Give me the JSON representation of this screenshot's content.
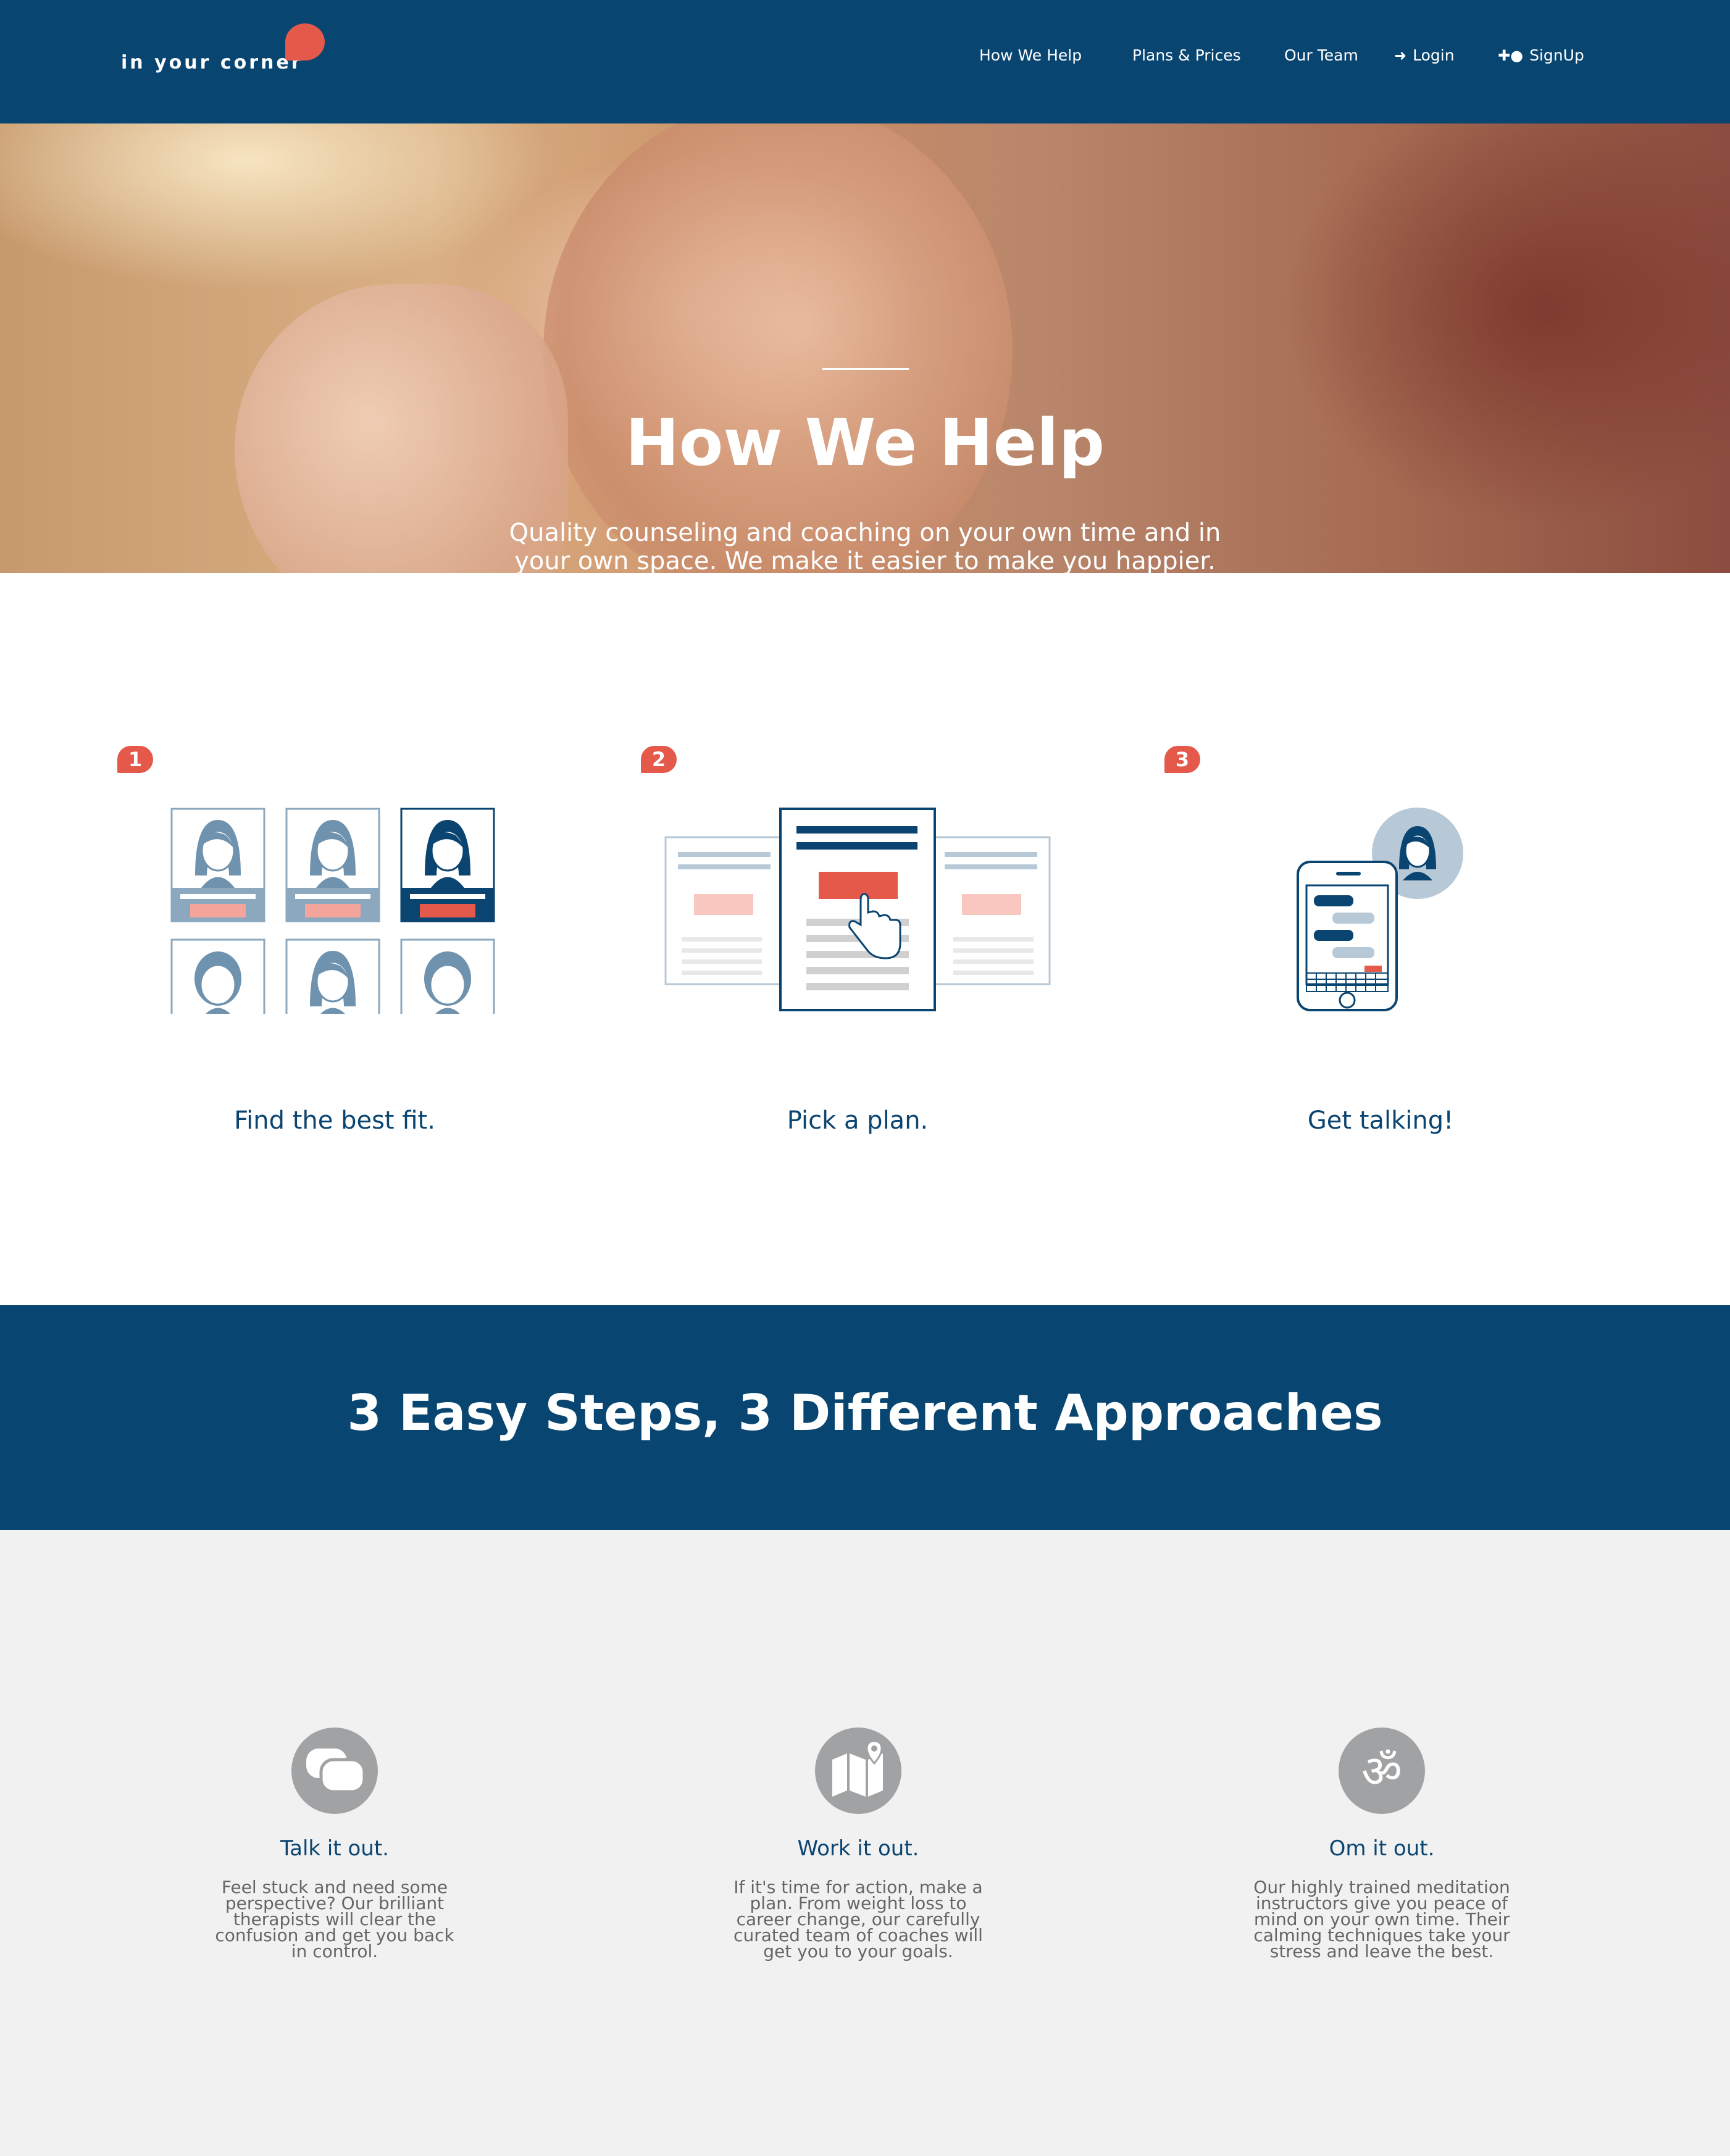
{
  "nav": {
    "logo": "in your corner",
    "links": [
      {
        "label": "How We Help",
        "icon": ""
      },
      {
        "label": "Plans & Prices",
        "icon": ""
      },
      {
        "label": "Our Team",
        "icon": ""
      },
      {
        "label": "Login",
        "icon": "login-icon"
      },
      {
        "label": "SignUp",
        "icon": "add-user-icon"
      }
    ]
  },
  "hero": {
    "title": "How We Help",
    "subtitle": "Quality counseling and coaching on your own time and in your own space. We make it easier to make you happier."
  },
  "steps": [
    {
      "number": "1",
      "caption": "Find the best fit."
    },
    {
      "number": "2",
      "caption": "Pick a plan."
    },
    {
      "number": "3",
      "caption": "Get talking!"
    }
  ],
  "band": {
    "title": "3 Easy Steps, 3 Different Approaches"
  },
  "approaches": [
    {
      "icon": "chat-bubbles-icon",
      "title": "Talk it out.",
      "text": "Feel stuck and need some perspective? Our brilliant therapists will clear the confusion and get you back in control."
    },
    {
      "icon": "map-pin-icon",
      "title": "Work it out.",
      "text": "If it's time for action, make a plan. From weight loss to career change, our carefully curated team of coaches will get you to your goals."
    },
    {
      "icon": "om-icon",
      "title": "Om it out.",
      "text": "Our highly trained meditation instructors give you peace of mind on your own time. Their calming techniques take your stress and leave the best."
    }
  ],
  "colors": {
    "navy": "#084571",
    "accent": "#e4594a",
    "light_bg": "#f1f1f1",
    "icon_grey": "#a1a2a4"
  }
}
